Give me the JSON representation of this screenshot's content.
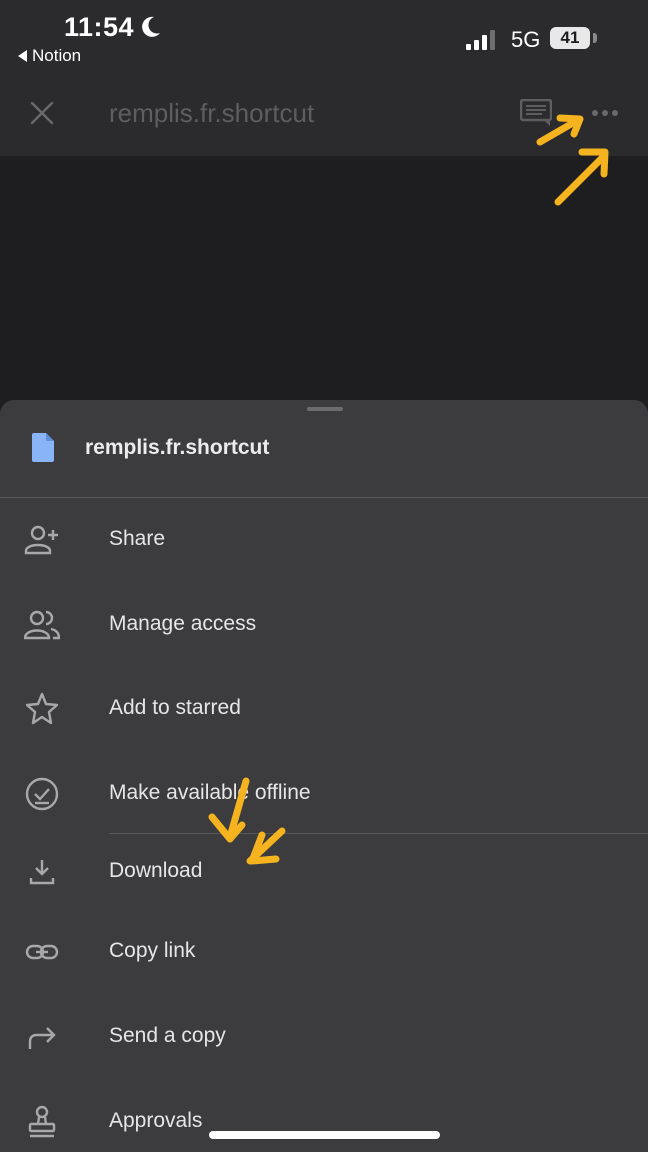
{
  "status_bar": {
    "time": "11:54",
    "back_app": "Notion",
    "network": "5G",
    "battery": "41"
  },
  "app_bar": {
    "title": "remplis.fr.shortcut"
  },
  "sheet": {
    "file_name": "remplis.fr.shortcut",
    "items": [
      {
        "label": "Share",
        "icon": "person-add-icon"
      },
      {
        "label": "Manage access",
        "icon": "people-icon"
      },
      {
        "label": "Add to starred",
        "icon": "star-outline-icon"
      },
      {
        "label": "Make available offline",
        "icon": "offline-check-icon"
      },
      {
        "label": "Download",
        "icon": "download-icon"
      },
      {
        "label": "Copy link",
        "icon": "link-icon"
      },
      {
        "label": "Send a copy",
        "icon": "forward-arrow-icon"
      },
      {
        "label": "Approvals",
        "icon": "stamp-icon"
      }
    ]
  },
  "colors": {
    "annotation_arrow": "#f5b41f",
    "file_icon": "#8ab4f8",
    "sheet_background": "#3c3c3f"
  }
}
